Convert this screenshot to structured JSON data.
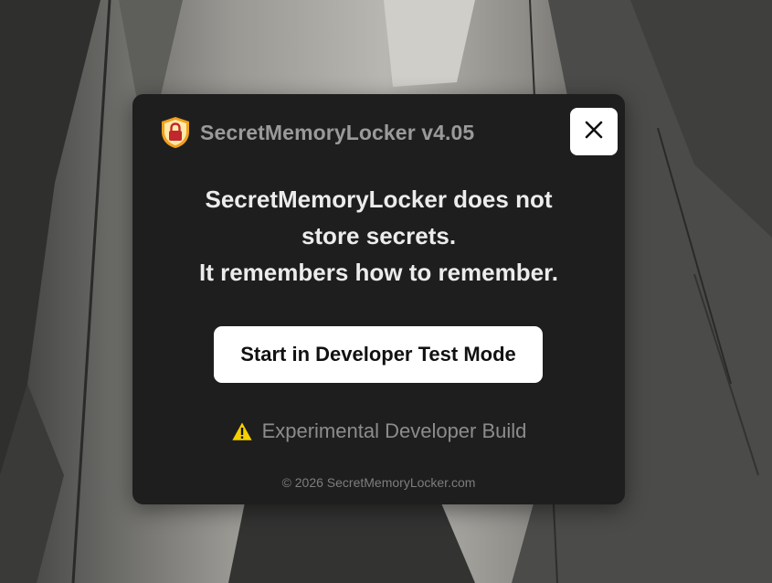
{
  "dialog": {
    "app_title": "SecretMemoryLocker v4.05",
    "close_symbol": "✕",
    "message_lines": [
      "SecretMemoryLocker does not",
      "store secrets.",
      "It remembers how to remember."
    ],
    "start_button_label": "Start in Developer Test Mode",
    "warning_text": "Experimental Developer Build",
    "footer_text": "© 2026 SecretMemoryLocker.com"
  },
  "icons": {
    "app": "shield-lock-icon",
    "close": "close-icon",
    "warning": "warning-icon"
  },
  "colors": {
    "dialog_bg": "#1e1e1e",
    "button_bg": "#ffffff",
    "shield_orange": "#f0a020",
    "lock_red": "#c0282d",
    "warning_yellow": "#f5d000"
  }
}
